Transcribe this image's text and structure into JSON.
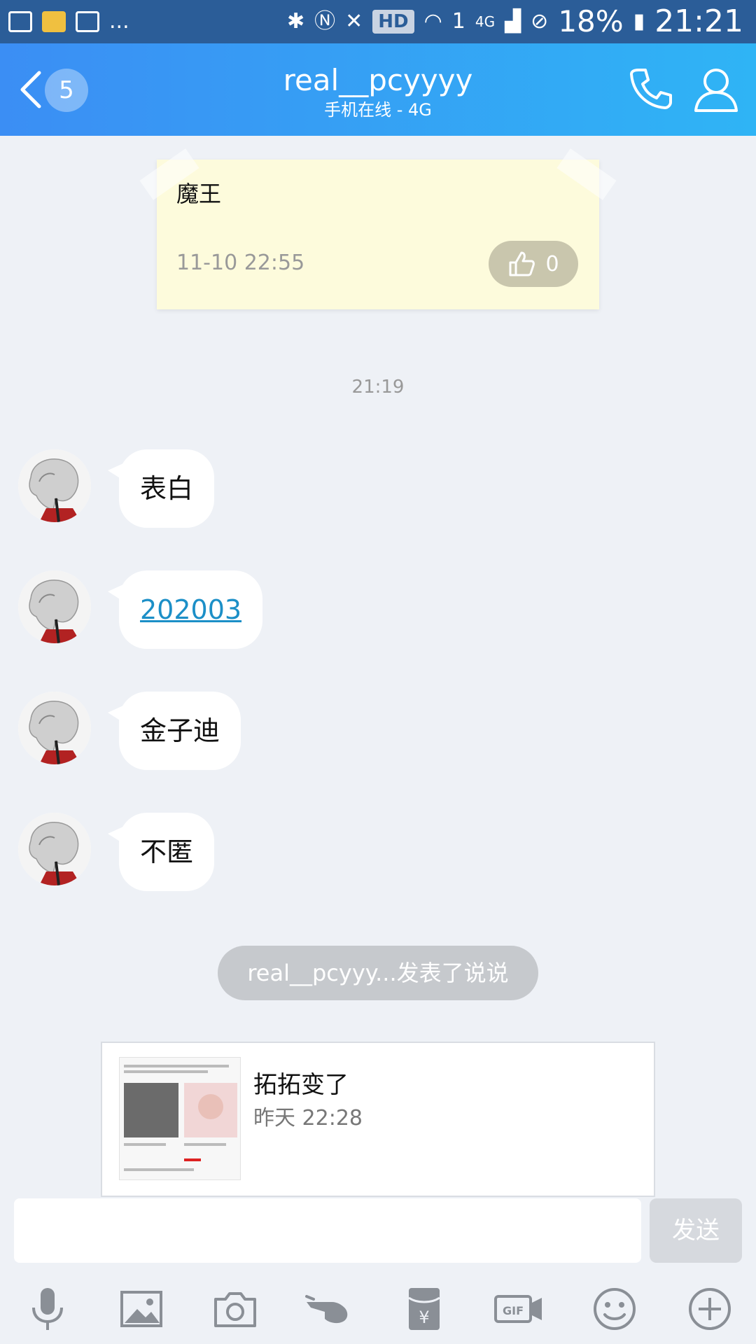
{
  "status_bar": {
    "more": "...",
    "hd": "HD",
    "network": "4G",
    "sim": "1",
    "battery": "18%",
    "time": "21:21"
  },
  "header": {
    "back_badge": "5",
    "title": "real__pcyyyy",
    "subtitle": "手机在线 - 4G"
  },
  "note_card": {
    "title": "魔王",
    "time": "11-10 22:55",
    "like_count": "0"
  },
  "time_divider": "21:19",
  "messages": [
    {
      "text": "表白",
      "is_link": false
    },
    {
      "text": "202003",
      "is_link": true
    },
    {
      "text": "金子迪",
      "is_link": false
    },
    {
      "text": "不匿",
      "is_link": false
    }
  ],
  "system_notice": "real__pcyyy...发表了说说",
  "share_card": {
    "title": "拓拓变了",
    "time": "昨天 22:28"
  },
  "input": {
    "value": "",
    "send_label": "发送"
  },
  "toolbar": {
    "icons": [
      "microphone-icon",
      "image-icon",
      "camera-icon",
      "poke-icon",
      "red-packet-icon",
      "gif-icon",
      "emoji-icon",
      "plus-icon"
    ]
  },
  "colors": {
    "header_start": "#3b8ef4",
    "header_end": "#2fb4f5",
    "status_bar": "#2b5d98",
    "chat_bg": "#eef1f6",
    "link": "#1c8fc7"
  }
}
